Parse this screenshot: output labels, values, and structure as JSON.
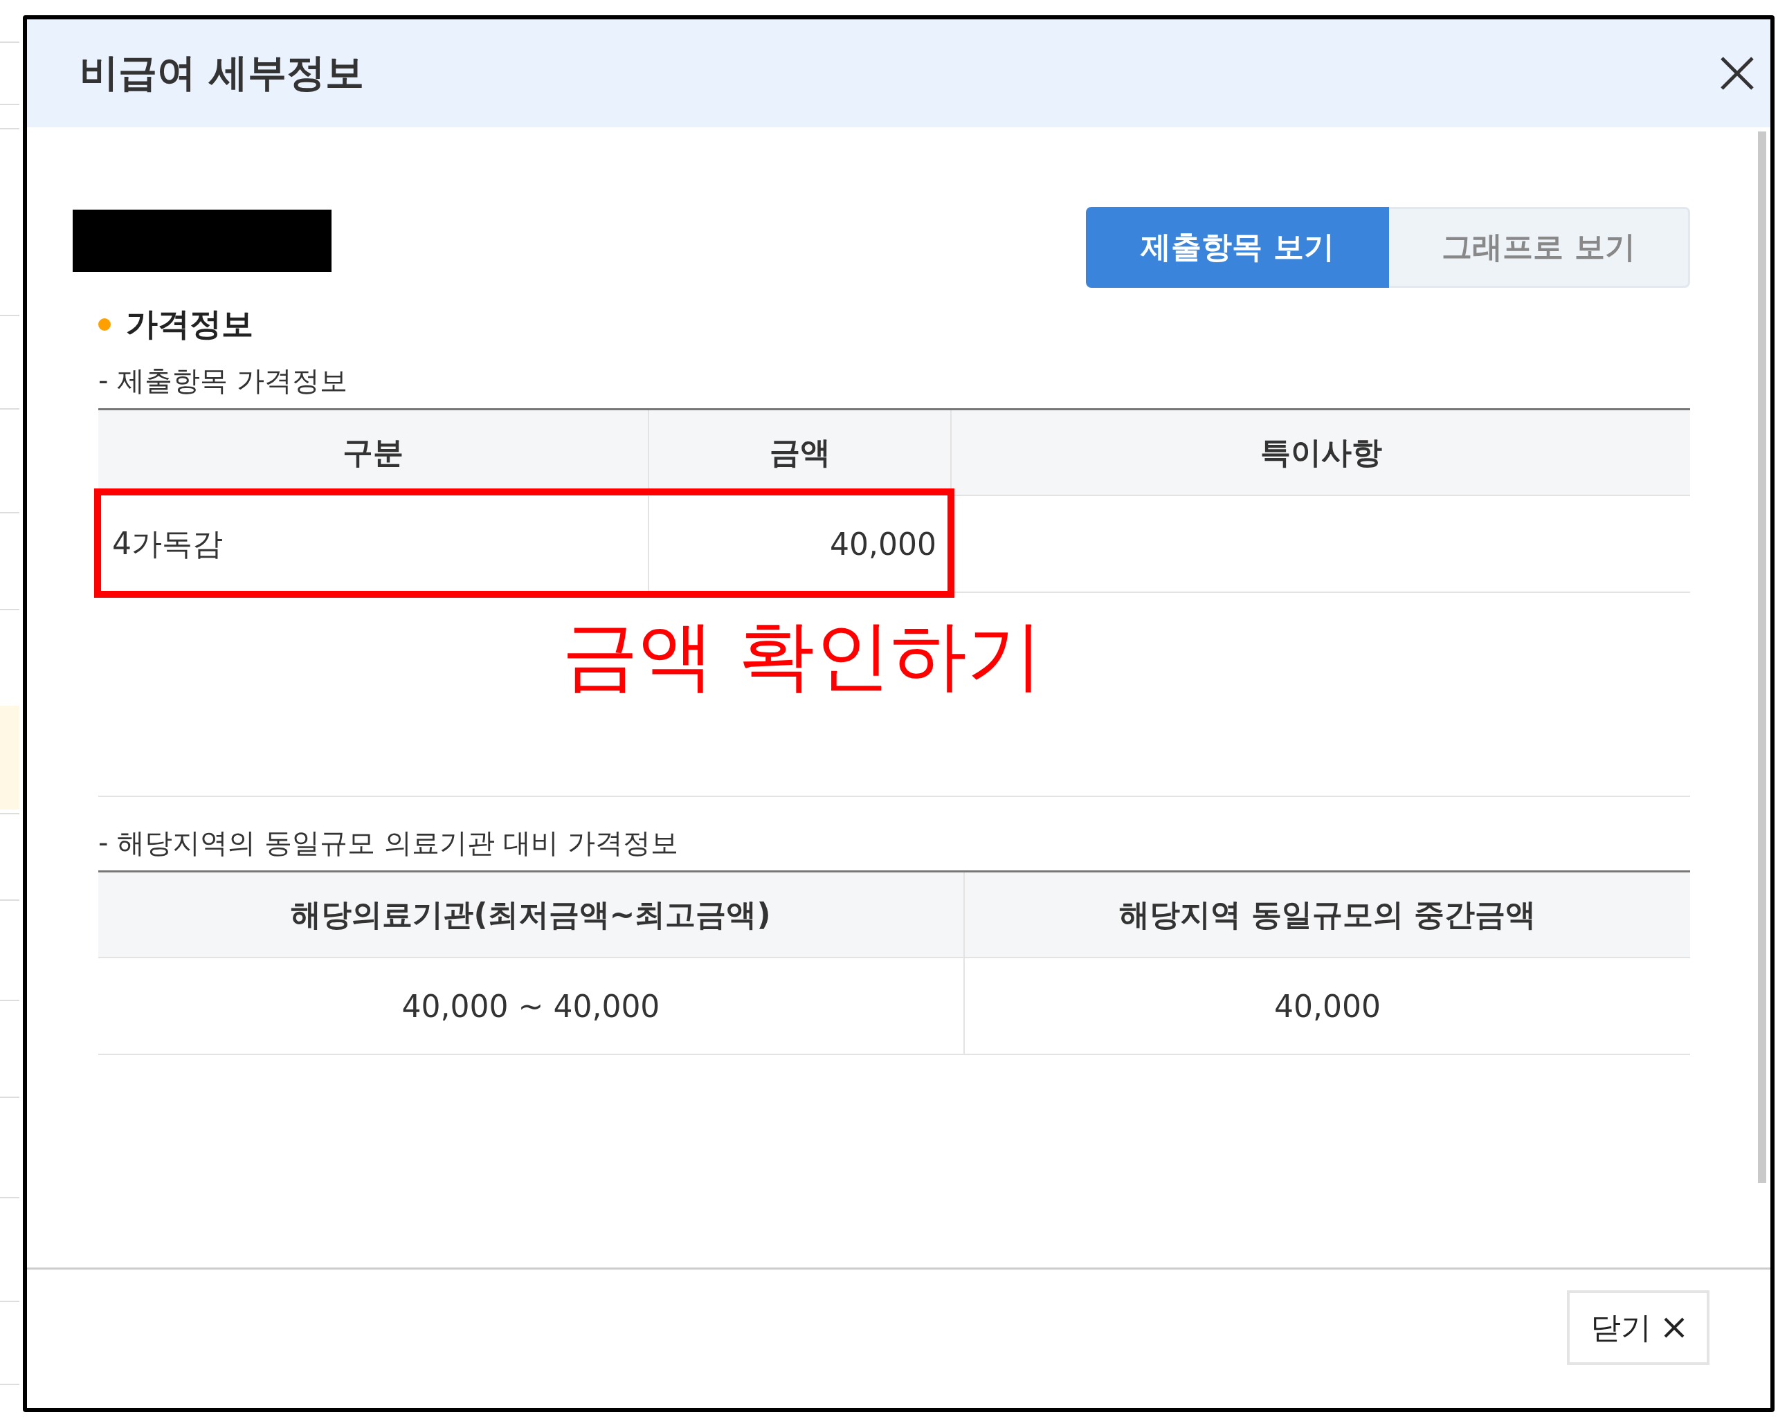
{
  "dialog": {
    "title": "비급여 세부정보"
  },
  "view_tabs": [
    {
      "label": "제출항목 보기",
      "selected": true
    },
    {
      "label": "그래프로 보기",
      "selected": false
    }
  ],
  "section": {
    "title": "가격정보"
  },
  "submitted_table": {
    "caption": "- 제출항목 가격정보",
    "columns": [
      "구분",
      "금액",
      "특이사항"
    ],
    "rows": [
      [
        "4가독감",
        "40,000",
        ""
      ]
    ]
  },
  "annotation": {
    "text": "금액 확인하기"
  },
  "regional_table": {
    "caption": "- 해당지역의 동일규모 의료기관 대비 가격정보",
    "columns": [
      "해당의료기관(최저금액~최고금액)",
      "해당지역 동일규모의 중간금액"
    ],
    "rows": [
      [
        "40,000 ~ 40,000",
        "40,000"
      ]
    ]
  },
  "footer": {
    "close_label": "닫기"
  }
}
